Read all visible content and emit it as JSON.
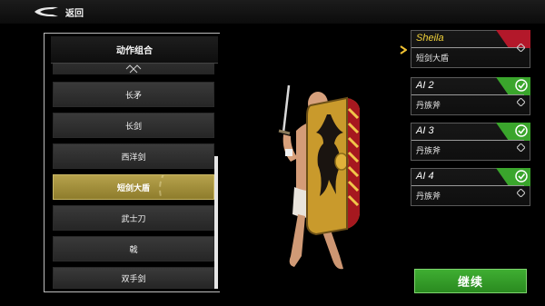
{
  "topbar": {
    "back_label": "返回"
  },
  "panel": {
    "title": "动作组合",
    "items": [
      {
        "label": "长矛",
        "selected": false
      },
      {
        "label": "长剑",
        "selected": false
      },
      {
        "label": "西洋剑",
        "selected": false
      },
      {
        "label": "短剑大盾",
        "selected": true
      },
      {
        "label": "武士刀",
        "selected": false
      },
      {
        "label": "戟",
        "selected": false
      },
      {
        "label": "双手剑",
        "selected": false
      }
    ]
  },
  "slots": [
    {
      "name": "Sheila",
      "weapon": "短剑大盾",
      "status": "active",
      "flag_color": "#b3182a"
    },
    {
      "name": "AI 2",
      "weapon": "丹族斧",
      "status": "ready",
      "flag_color": "#3aa52c"
    },
    {
      "name": "AI 3",
      "weapon": "丹族斧",
      "status": "ready",
      "flag_color": "#3aa52c"
    },
    {
      "name": "AI 4",
      "weapon": "丹族斧",
      "status": "ready",
      "flag_color": "#3aa52c"
    }
  ],
  "continue_label": "继续",
  "icons": {
    "back": "back-arrow-icon",
    "check": "check-icon",
    "selector": "selector-arrow-icon",
    "diamond": "diamond-icon"
  },
  "colors": {
    "selected_item": "#a8953f",
    "active_name": "#f1d23a",
    "ready_flag": "#3aa52c",
    "active_flag": "#b3182a",
    "continue": "#2f9a24"
  }
}
